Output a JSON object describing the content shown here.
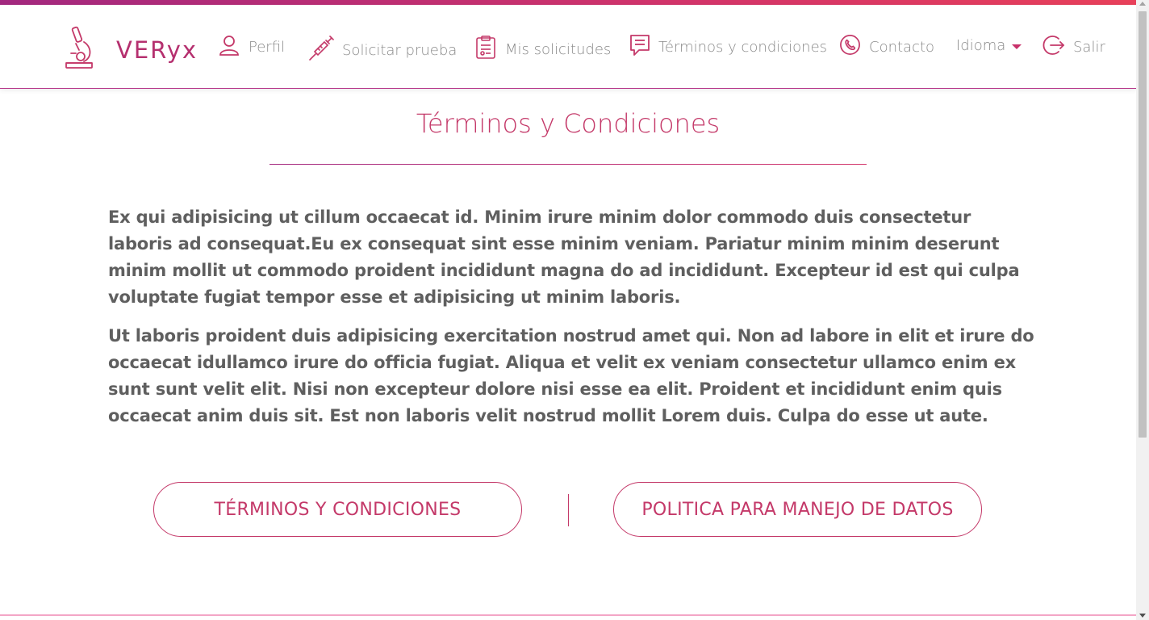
{
  "brand": {
    "name": "VERyx"
  },
  "nav": {
    "profile": "Perfil",
    "request_test": "Solicitar prueba",
    "my_requests": "Mis solicitudes",
    "terms": "Términos y condiciones",
    "contact": "Contacto",
    "language": "Idioma",
    "logout": "Salir"
  },
  "page": {
    "title": "Términos y Condiciones",
    "paragraphs": [
      "Ex qui adipisicing ut cillum occaecat id. Minim irure minim dolor commodo duis consectetur laboris ad consequat.Eu ex consequat sint esse minim veniam. Pariatur minim minim deserunt minim mollit ut commodo proident incididunt magna do ad incididunt. Excepteur id est qui culpa voluptate fugiat tempor esse et adipisicing ut minim laboris.",
      "Ut laboris proident duis adipisicing exercitation nostrud amet qui. Non ad labore in elit et irure do occaecat idullamco irure do officia fugiat. Aliqua et velit ex veniam consectetur ullamco enim ex sunt sunt velit elit. Nisi non excepteur dolore nisi esse ea elit. Proident et incididunt enim quis occaecat anim duis sit. Est non laboris velit nostrud mollit Lorem duis. Culpa do esse ut aute."
    ]
  },
  "buttons": {
    "terms": "TÉRMINOS Y CONDICIONES",
    "data_policy": "POLITICA PARA MANEJO DE DATOS"
  },
  "colors": {
    "accent": "#c43969",
    "accent_purple": "#a3287f",
    "text": "#5f5f5f",
    "nav_text": "#8a8a8a"
  },
  "icons": {
    "brand": "microscope-icon",
    "profile": "user-icon",
    "request_test": "syringe-icon",
    "my_requests": "clipboard-icon",
    "terms": "chat-bubble-icon",
    "contact": "phone-icon",
    "language": "caret-down-icon",
    "logout": "logout-icon"
  }
}
